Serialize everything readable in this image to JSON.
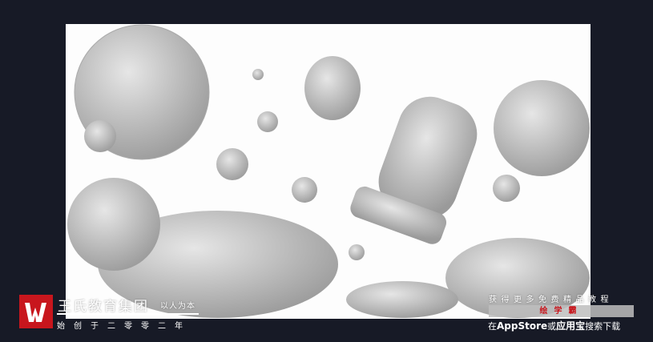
{
  "brand": {
    "name": "王氏教育集团",
    "slogan": "以人为本",
    "since": "始创于二零零二年",
    "logo_icon": "w-logo-icon",
    "logo_color": "#c8161d"
  },
  "promo": {
    "line1": "获得更多免费精品教程",
    "app_name": "绘学霸",
    "line3_prefix": "在",
    "line3_store": "AppStore",
    "line3_or": "或",
    "line3_app": "应用宝",
    "line3_suffix": "搜索下载"
  }
}
